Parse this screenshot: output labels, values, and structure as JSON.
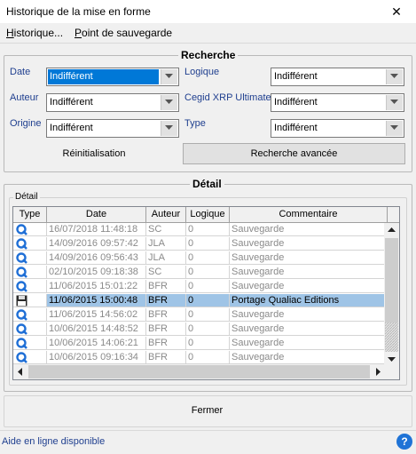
{
  "window": {
    "title": "Historique de la mise en forme",
    "close_glyph": "✕"
  },
  "menu": {
    "items": [
      "Historique...",
      "Point de sauvegarde"
    ]
  },
  "search": {
    "title": "Recherche",
    "date_label": "Date",
    "date_value": "Indifférent",
    "logique_label": "Logique",
    "logique_value": "Indifférent",
    "auteur_label": "Auteur",
    "auteur_value": "Indifférent",
    "cegid_label": "Cegid XRP Ultimate",
    "cegid_value": "Indifférent",
    "origine_label": "Origine",
    "origine_value": "Indifférent",
    "type_label": "Type",
    "type_value": "Indifférent",
    "reset_label": "Réinitialisation",
    "advanced_label": "Recherche avancée"
  },
  "detail": {
    "title": "Détail",
    "subtitle": "Détail",
    "columns": [
      "Type",
      "Date",
      "Auteur",
      "Logique",
      "Commentaire"
    ],
    "rows": [
      {
        "icon": "q-icon",
        "date": "16/07/2018 11:48:18",
        "author": "SC",
        "logic": "0",
        "comment": "Sauvegarde"
      },
      {
        "icon": "q-icon",
        "date": "14/09/2016 09:57:42",
        "author": "JLA",
        "logic": "0",
        "comment": "Sauvegarde"
      },
      {
        "icon": "q-icon",
        "date": "14/09/2016 09:56:43",
        "author": "JLA",
        "logic": "0",
        "comment": "Sauvegarde"
      },
      {
        "icon": "q-icon",
        "date": "02/10/2015 09:18:38",
        "author": "SC",
        "logic": "0",
        "comment": "Sauvegarde"
      },
      {
        "icon": "q-icon",
        "date": "11/06/2015 15:01:22",
        "author": "BFR",
        "logic": "0",
        "comment": "Sauvegarde"
      },
      {
        "icon": "floppy-icon",
        "date": "11/06/2015 15:00:48",
        "author": "BFR",
        "logic": "0",
        "comment": "Portage Qualiac Editions",
        "selected": true
      },
      {
        "icon": "q-icon",
        "date": "11/06/2015 14:56:02",
        "author": "BFR",
        "logic": "0",
        "comment": "Sauvegarde"
      },
      {
        "icon": "q-icon",
        "date": "10/06/2015 14:48:52",
        "author": "BFR",
        "logic": "0",
        "comment": "Sauvegarde"
      },
      {
        "icon": "q-icon",
        "date": "10/06/2015 14:06:21",
        "author": "BFR",
        "logic": "0",
        "comment": "Sauvegarde"
      },
      {
        "icon": "q-icon",
        "date": "10/06/2015 09:16:34",
        "author": "BFR",
        "logic": "0",
        "comment": "Sauvegarde"
      }
    ]
  },
  "footer": {
    "close_label": "Fermer"
  },
  "status": {
    "text": "Aide en ligne disponible",
    "help_glyph": "?"
  },
  "colors": {
    "selection": "#0078d7",
    "row_selected": "#9fc4e6",
    "label": "#1f3f8f",
    "q_icon": "#1f6fd6"
  }
}
